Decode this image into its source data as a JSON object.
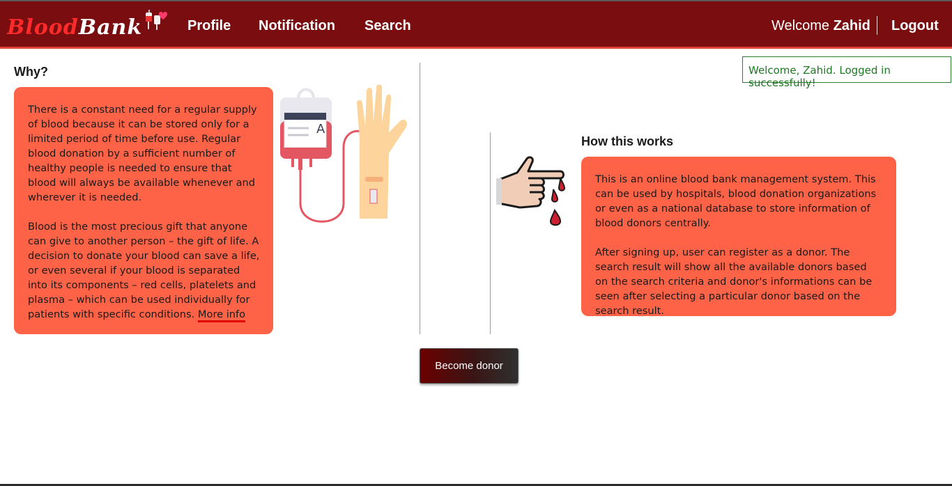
{
  "nav": {
    "logo_blood": "Blood",
    "logo_bank": "Bank",
    "links": [
      "Profile",
      "Notification",
      "Search"
    ],
    "welcome_prefix": "Welcome",
    "user_name": "Zahid",
    "logout": "Logout"
  },
  "alert": {
    "message": "Welcome, Zahid. Logged in successfully!"
  },
  "why": {
    "title": "Why?",
    "paragraph1": "There is a constant need for a regular supply of blood because it can be stored only for a limited period of time before use. Regular blood donation by a sufficient number of healthy people is needed to ensure that blood will always be available whenever and wherever it is needed.",
    "paragraph2": "Blood is the most precious gift that anyone can give to another person – the gift of life. A decision to donate your blood can save a life, or even several if your blood is separated into its components – red cells, platelets and plasma – which can be used individually for patients with specific conditions.",
    "more_info": "More info",
    "bag_label": "A"
  },
  "how": {
    "title": "How this works",
    "paragraph1": "This is an online blood bank management system. This can be used by hospitals, blood donation organizations or even as a national database to store information of blood donors centrally.",
    "paragraph2": "After signing up, user can register as a donor. The search result will show all the available donors based on the search criteria and donor's informations can be seen after selecting a particular donor based on the search result."
  },
  "button": {
    "become_donor": "Become donor"
  },
  "colors": {
    "navbar": "#7a0d10",
    "card": "#ff6347",
    "alert": "#2e7d32",
    "accent_underline": "#e00000"
  },
  "icons": [
    "logo-blood-bag-icon",
    "blood-bag-illustration",
    "bleeding-finger-illustration"
  ]
}
